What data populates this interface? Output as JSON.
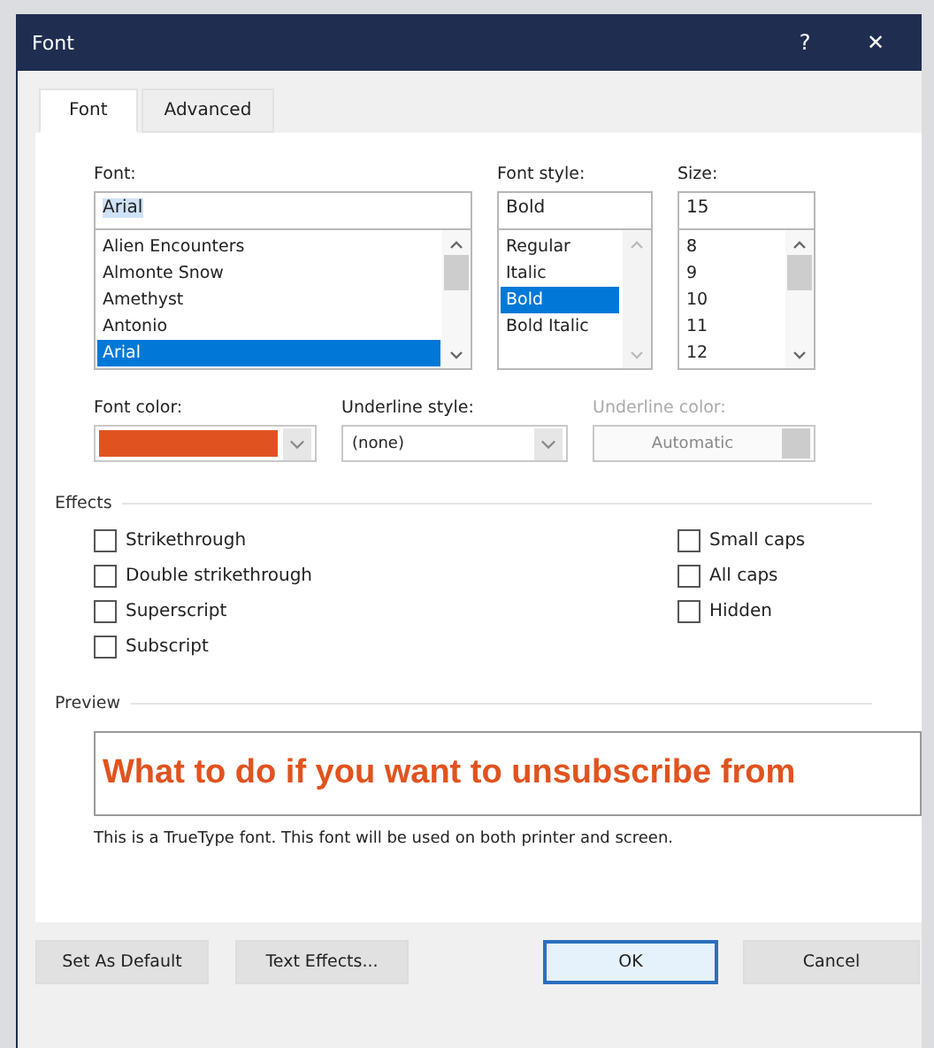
{
  "window": {
    "title": "Font",
    "help": "?",
    "close": "✕"
  },
  "tabs": [
    {
      "label": "Font",
      "selected": true
    },
    {
      "label": "Advanced",
      "selected": false
    }
  ],
  "font": {
    "label": "Font:",
    "value": "Arial",
    "items": [
      {
        "label": "Alien Encounters",
        "selected": false
      },
      {
        "label": "Almonte Snow",
        "selected": false
      },
      {
        "label": "Amethyst",
        "selected": false
      },
      {
        "label": "Antonio",
        "selected": false
      },
      {
        "label": "Arial",
        "selected": true
      }
    ]
  },
  "font_style": {
    "label": "Font style:",
    "value": "Bold",
    "items": [
      {
        "label": "Regular",
        "selected": false
      },
      {
        "label": "Italic",
        "selected": false
      },
      {
        "label": "Bold",
        "selected": true
      },
      {
        "label": "Bold Italic",
        "selected": false
      }
    ]
  },
  "size": {
    "label": "Size:",
    "value": "15",
    "items": [
      {
        "label": "8",
        "selected": false
      },
      {
        "label": "9",
        "selected": false
      },
      {
        "label": "10",
        "selected": false
      },
      {
        "label": "11",
        "selected": false
      },
      {
        "label": "12",
        "selected": false
      }
    ]
  },
  "font_color": {
    "label": "Font color:",
    "color": "#e0531f"
  },
  "underline_style": {
    "label": "Underline style:",
    "value": "(none)"
  },
  "underline_color": {
    "label": "Underline color:",
    "value": "Automatic",
    "disabled": true
  },
  "effects": {
    "label": "Effects",
    "left": [
      {
        "label": "Strikethrough",
        "checked": false
      },
      {
        "label": "Double strikethrough",
        "checked": false
      },
      {
        "label": "Superscript",
        "checked": false
      },
      {
        "label": "Subscript",
        "checked": false
      }
    ],
    "right": [
      {
        "label": "Small caps",
        "checked": false
      },
      {
        "label": "All caps",
        "checked": false
      },
      {
        "label": "Hidden",
        "checked": false
      }
    ]
  },
  "preview": {
    "label": "Preview",
    "text": "What to do if you want to unsubscribe from",
    "note": "This is a TrueType font. This font will be used on both printer and screen."
  },
  "buttons": [
    {
      "label": "Set As Default",
      "default": false
    },
    {
      "label": "Text Effects...",
      "default": false
    },
    {
      "label": "OK",
      "default": true
    },
    {
      "label": "Cancel",
      "default": false
    }
  ]
}
